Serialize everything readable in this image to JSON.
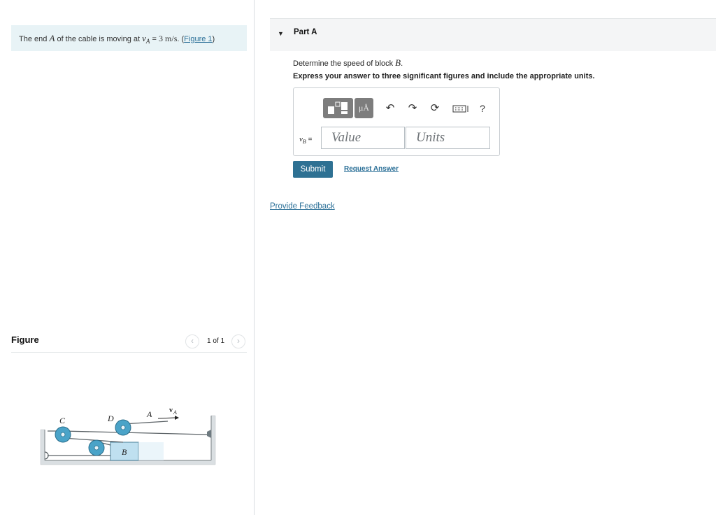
{
  "problem": {
    "text_before": "The end",
    "point": "A",
    "text_middle": "of the cable is moving at",
    "var_symbol": "v",
    "var_sub": "A",
    "equals": "=",
    "value": "3",
    "unit": "m/s",
    "punct": ". (",
    "figure_link": "Figure 1",
    "close": ")"
  },
  "figure_panel": {
    "title": "Figure",
    "pager_text": "1 of 1",
    "prev_icon": "chevron-left-icon",
    "next_icon": "chevron-right-icon",
    "labels": {
      "c": "C",
      "d": "D",
      "a": "A",
      "va": "v",
      "va_sub": "A",
      "b": "B"
    },
    "colors": {
      "pulley": "#4aa3c8",
      "block": "#bfe0f0",
      "ground": "#dadfe2"
    }
  },
  "part": {
    "caret_icon": "caret-down-icon",
    "title": "Part A",
    "question_text": "Determine the speed of block",
    "question_var": "B",
    "question_end": ".",
    "instruction": "Express your answer to three significant figures and include the appropriate units."
  },
  "answer": {
    "var_symbol": "v",
    "var_sub": "B",
    "equals": "=",
    "value_placeholder": "Value",
    "units_placeholder": "Units",
    "toolbar": {
      "units_label": "μÅ",
      "undo": "↶",
      "redo": "↷",
      "reset": "⟳",
      "help": "?"
    }
  },
  "actions": {
    "submit_label": "Submit",
    "request_label": "Request Answer",
    "feedback_label": "Provide Feedback"
  },
  "colors": {
    "accent": "#2e7193",
    "link": "#2a6f97",
    "problem_bg": "#e8f3f6"
  }
}
